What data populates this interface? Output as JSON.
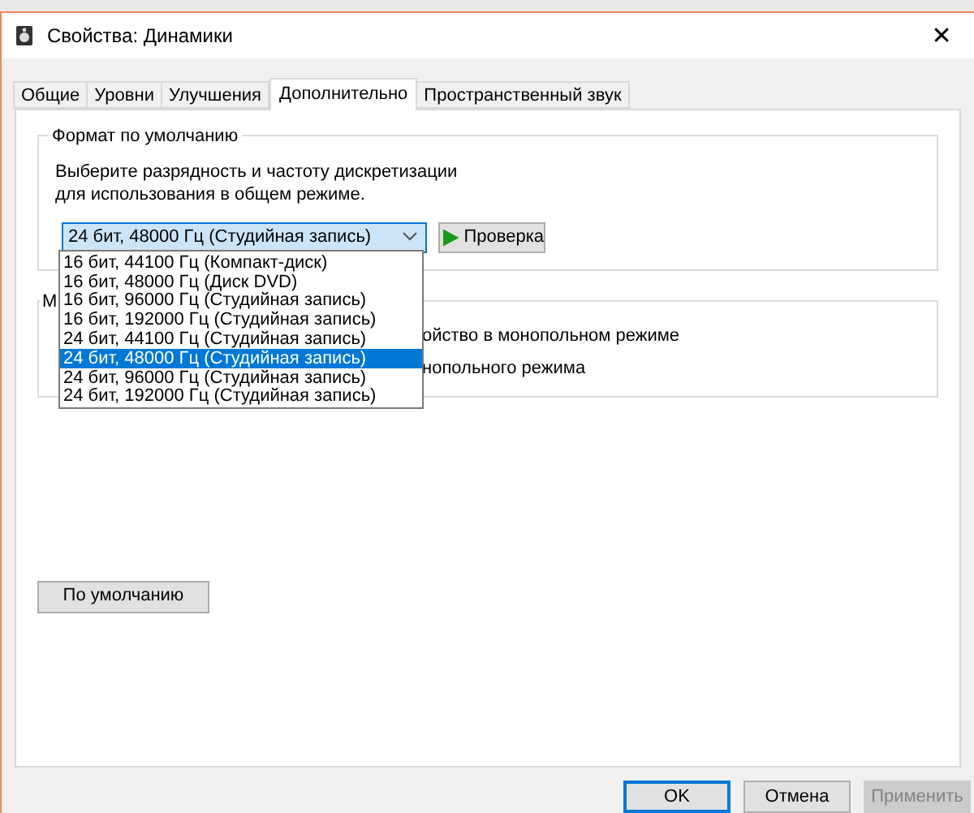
{
  "window": {
    "title": "Свойства: Динамики",
    "close": "✕"
  },
  "tabs": [
    {
      "label": "Общие",
      "selected": false
    },
    {
      "label": "Уровни",
      "selected": false
    },
    {
      "label": "Улучшения",
      "selected": false
    },
    {
      "label": "Дополнительно",
      "selected": true
    },
    {
      "label": "Пространственный звук",
      "selected": false
    }
  ],
  "default_format": {
    "title": "Формат по умолчанию",
    "description": "Выберите разрядность и частоту дискретизации для использования в общем режиме.",
    "value": "24 бит, 48000 Гц (Студийная запись)",
    "expanded": true,
    "options": [
      {
        "label": "16 бит, 44100 Гц (Компакт-диск)",
        "selected": false
      },
      {
        "label": "16 бит, 48000 Гц (Диск DVD)",
        "selected": false
      },
      {
        "label": "16 бит, 96000 Гц (Студийная запись)",
        "selected": false
      },
      {
        "label": "16 бит, 192000 Гц (Студийная запись)",
        "selected": false
      },
      {
        "label": "24 бит, 44100 Гц (Студийная запись)",
        "selected": false
      },
      {
        "label": "24 бит, 48000 Гц (Студийная запись)",
        "selected": true
      },
      {
        "label": "24 бит, 96000 Гц (Студийная запись)",
        "selected": false
      },
      {
        "label": "24 бит, 192000 Гц (Студийная запись)",
        "selected": false
      }
    ],
    "test_button": "Проверка"
  },
  "exclusive_mode": {
    "title": "М",
    "rows": [
      "ойство в монопольном режиме",
      "нопольного режима"
    ]
  },
  "restore_button": "По умолчанию",
  "buttons": [
    {
      "label": "OK",
      "kind": "default"
    },
    {
      "label": "Отмена",
      "kind": "normal"
    },
    {
      "label": "Применить",
      "kind": "disabled"
    }
  ]
}
